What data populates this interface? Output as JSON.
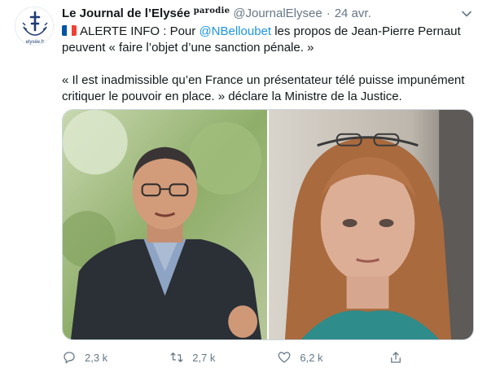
{
  "account": {
    "display_name": "Le Journal de l’Elysée",
    "parody_label": "parodie",
    "handle": "@JournalElysee",
    "separator": "·",
    "date": "24 avr.",
    "avatar_caption": "elysée.fr"
  },
  "tweet": {
    "line1_prefix": "ALERTE INFO : Pour ",
    "mention": "@NBelloubet",
    "line1_suffix": " les propos de Jean-Pierre Pernaut",
    "line2": "peuvent « faire l’objet d’une sanction pénale. »",
    "line3": "« Il est inadmissible qu’en France un présentateur télé puisse impunément",
    "line4": "critiquer le pouvoir en place. » déclare la Ministre de la Justice."
  },
  "actions": {
    "replies": "2,3 k",
    "retweets": "2,7 k",
    "likes": "6,2 k"
  },
  "colors": {
    "text": "#14171a",
    "secondary": "#657786",
    "link": "#1b95e0",
    "flag_blue": "#0055a4",
    "flag_white": "#ffffff",
    "flag_red": "#ef4135"
  }
}
